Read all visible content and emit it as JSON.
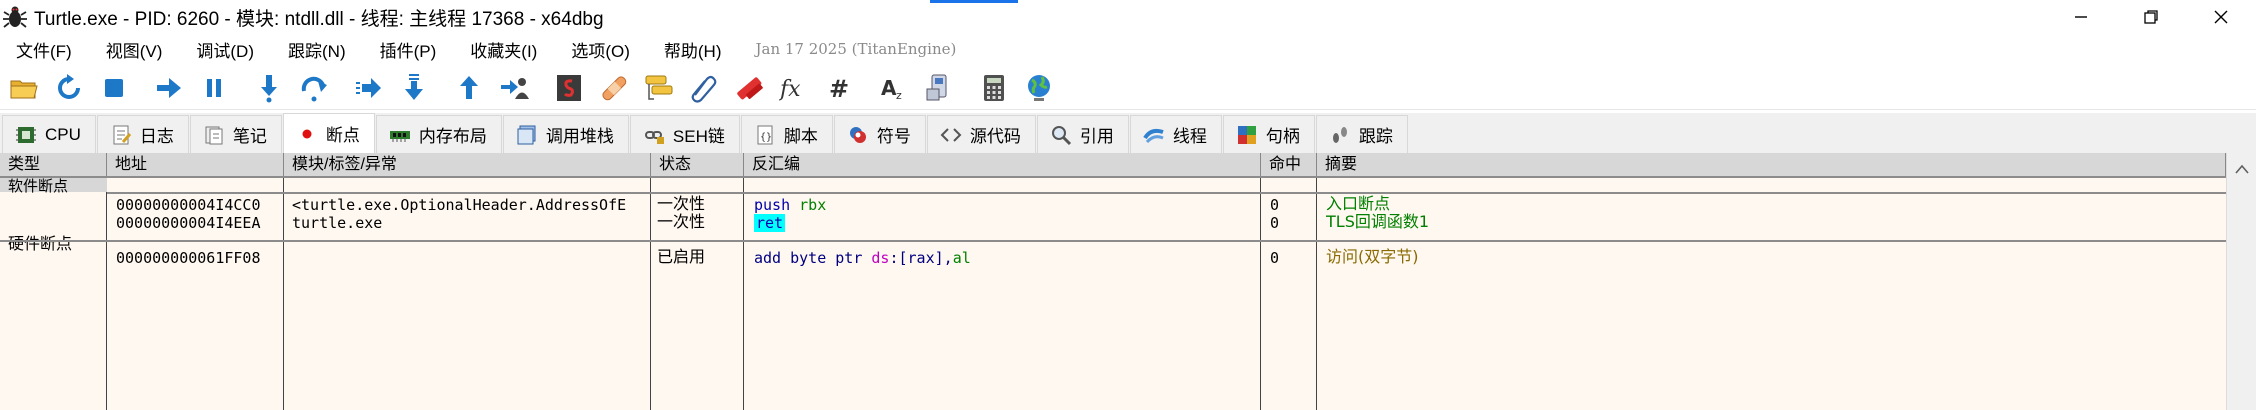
{
  "window": {
    "title": "Turtle.exe - PID: 6260 - 模块: ntdll.dll - 线程: 主线程 17368 - x64dbg",
    "controls": {
      "minimize": "minimize-icon",
      "maximize": "restore-icon",
      "close": "close-icon"
    }
  },
  "menu": {
    "items": [
      "文件(F)",
      "视图(V)",
      "调试(D)",
      "跟踪(N)",
      "插件(P)",
      "收藏夹(I)",
      "选项(O)",
      "帮助(H)"
    ],
    "date": "Jan 17 2025 (TitanEngine)"
  },
  "toolbar": {
    "icons": [
      "open-folder-icon",
      "restart-icon",
      "stop-icon",
      "run-icon",
      "pause-icon",
      "step-into-icon",
      "step-over-icon",
      "trace-into-icon",
      "trace-over-icon",
      "execute-till-return-icon",
      "run-to-user-code-icon",
      "scylla-icon",
      "patch-icon",
      "comments-icon",
      "labels-icon",
      "bookmarks-icon",
      "functions-icon",
      "hash-icon",
      "font-icon",
      "memory-map-icon",
      "calculator-icon",
      "web-globe-icon"
    ]
  },
  "tabs": [
    {
      "label": "CPU",
      "icon": "cpu-icon"
    },
    {
      "label": "日志",
      "icon": "log-icon"
    },
    {
      "label": "笔记",
      "icon": "notes-icon"
    },
    {
      "label": "断点",
      "icon": "breakpoint-icon",
      "active": true
    },
    {
      "label": "内存布局",
      "icon": "memory-icon"
    },
    {
      "label": "调用堆栈",
      "icon": "callstack-icon"
    },
    {
      "label": "SEH链",
      "icon": "seh-icon"
    },
    {
      "label": "脚本",
      "icon": "script-icon"
    },
    {
      "label": "符号",
      "icon": "symbols-icon"
    },
    {
      "label": "源代码",
      "icon": "source-icon"
    },
    {
      "label": "引用",
      "icon": "references-icon"
    },
    {
      "label": "线程",
      "icon": "threads-icon"
    },
    {
      "label": "句柄",
      "icon": "handles-icon"
    },
    {
      "label": "跟踪",
      "icon": "trace-icon"
    }
  ],
  "breakpoints": {
    "columns": [
      "类型",
      "地址",
      "模块/标签/异常",
      "状态",
      "反汇编",
      "命中",
      "摘要"
    ],
    "software_label": "软件断点",
    "hardware_label": "硬件断点",
    "software": [
      {
        "address": "00000000004I4CC0",
        "module": "<turtle.exe.OptionalHeader.AddressOfE",
        "state": "一次性",
        "disasm": {
          "mnemonic": "push",
          "operand": "rbx"
        },
        "hits": "0",
        "summary": "入口断点"
      },
      {
        "address": "00000000004I4EEA",
        "module": "turtle.exe",
        "state": "一次性",
        "disasm": {
          "mnemonic": "ret",
          "operand": ""
        },
        "hits": "0",
        "summary": "TLS回调函数1"
      }
    ],
    "hardware": [
      {
        "address": "000000000061FF08",
        "module": "",
        "state": "已启用",
        "disasm": {
          "mnemonic": "add",
          "size": "byte",
          "ptr": "ptr",
          "segment": "ds",
          "operand_mem": "[rax]",
          "operand_reg": "al"
        },
        "hits": "0",
        "summary": "访问(双字节)"
      }
    ]
  },
  "colors": {
    "table_bg": "#fff8f0",
    "header_bg": "#d7d7d7",
    "ret_highlight": "#00ffff",
    "summary_green": "#008000",
    "summary_red": "#b00000"
  }
}
